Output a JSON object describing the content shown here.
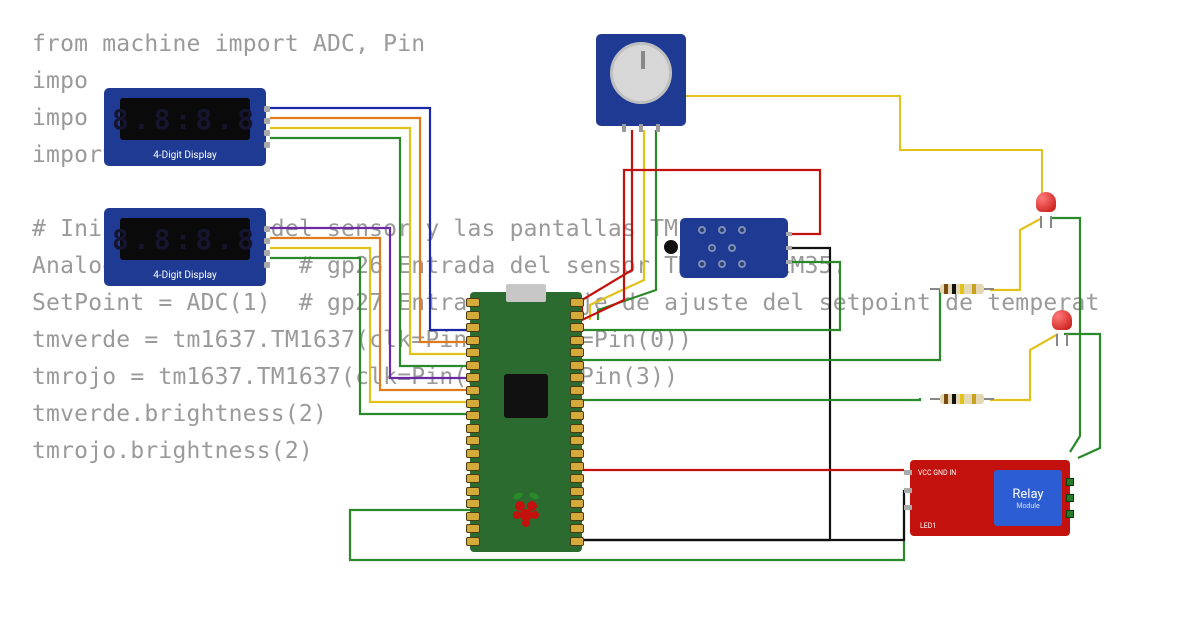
{
  "code_lines": [
    "from machine import ADC, Pin",
    "impo",
    "impo",
    "import math",
    "",
    "# Inicialización del sensor y las pantallas TM1637",
    "AnalogIn = ADC(0)  # gp26 Entrada del sensor TMP35 o LM35.",
    "SetPoint = ADC(1)  # gp27 Entrada voltaje de ajuste del setpoint de temperat",
    "tmverde = tm1637.TM1637(clk=Pin(1), dio=Pin(0))",
    "tmrojo = tm1637.TM1637(clk=Pin(2), dio=Pin(3))",
    "tmverde.brightness(2)",
    "tmrojo.brightness(2)"
  ],
  "display_label": "4-Digit Display",
  "display_value": "8.8:8.8",
  "relay": {
    "title": "Relay",
    "sub": "Module",
    "pins": "VCC\nGND\nIN",
    "led1": "LED1"
  },
  "components": {
    "pico": "Raspberry Pi Pico",
    "pot": "Potentiometer module",
    "therm": "NTC Thermistor module",
    "led1": "LED 1 (red)",
    "led2": "LED 2 (red)",
    "res1": "Resistor 1",
    "res2": "Resistor 2",
    "relay": "Relay module"
  },
  "wire_colors": {
    "red": "#c3110d",
    "black": "#111",
    "green": "#2a8a2a",
    "yellow": "#e2c21a",
    "blue": "#1a2aa6",
    "orange": "#e07a1a",
    "purple": "#6a2aa6"
  }
}
